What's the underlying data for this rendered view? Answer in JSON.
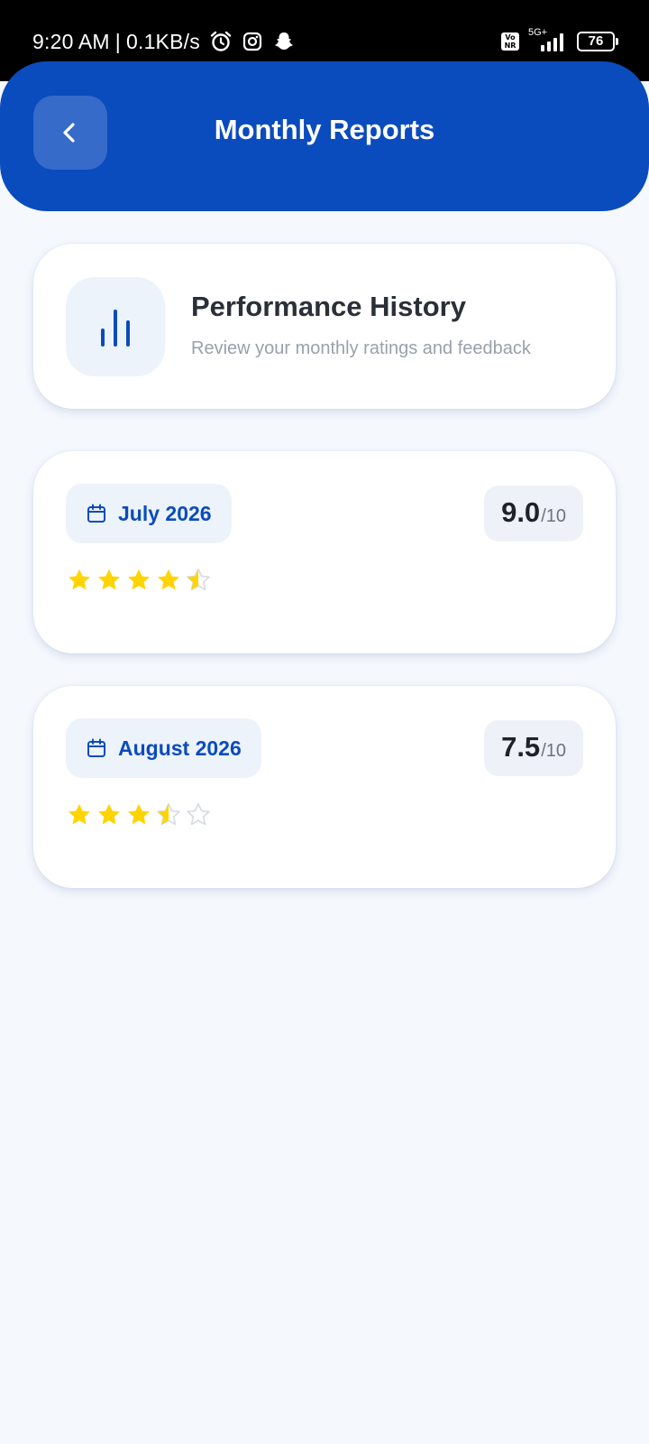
{
  "status_bar": {
    "time": "9:20 AM",
    "separator": "|",
    "network_speed": "0.1KB/s",
    "icons": [
      "alarm-icon",
      "instagram-icon",
      "snapchat-icon"
    ],
    "volte_label": "Vo\nNR",
    "network_type": "5G+",
    "battery_level": "76"
  },
  "header": {
    "title": "Monthly Reports",
    "back_icon": "chevron-left-icon",
    "color": "#0a4bbe"
  },
  "intro": {
    "icon": "bar-chart-icon",
    "title": "Performance History",
    "subtitle": "Review your monthly ratings and feedback"
  },
  "reports": [
    {
      "month": "July 2026",
      "score": "9.0",
      "score_max": "/10",
      "rating_stars": 4.5,
      "rating_out_of": 5
    },
    {
      "month": "August 2026",
      "score": "7.5",
      "score_max": "/10",
      "rating_stars": 3.5,
      "rating_out_of": 5
    }
  ],
  "colors": {
    "accent": "#0a4bbe",
    "star_filled": "#ffd400",
    "star_empty": "#d9dde3",
    "background": "#f5f8fd"
  }
}
